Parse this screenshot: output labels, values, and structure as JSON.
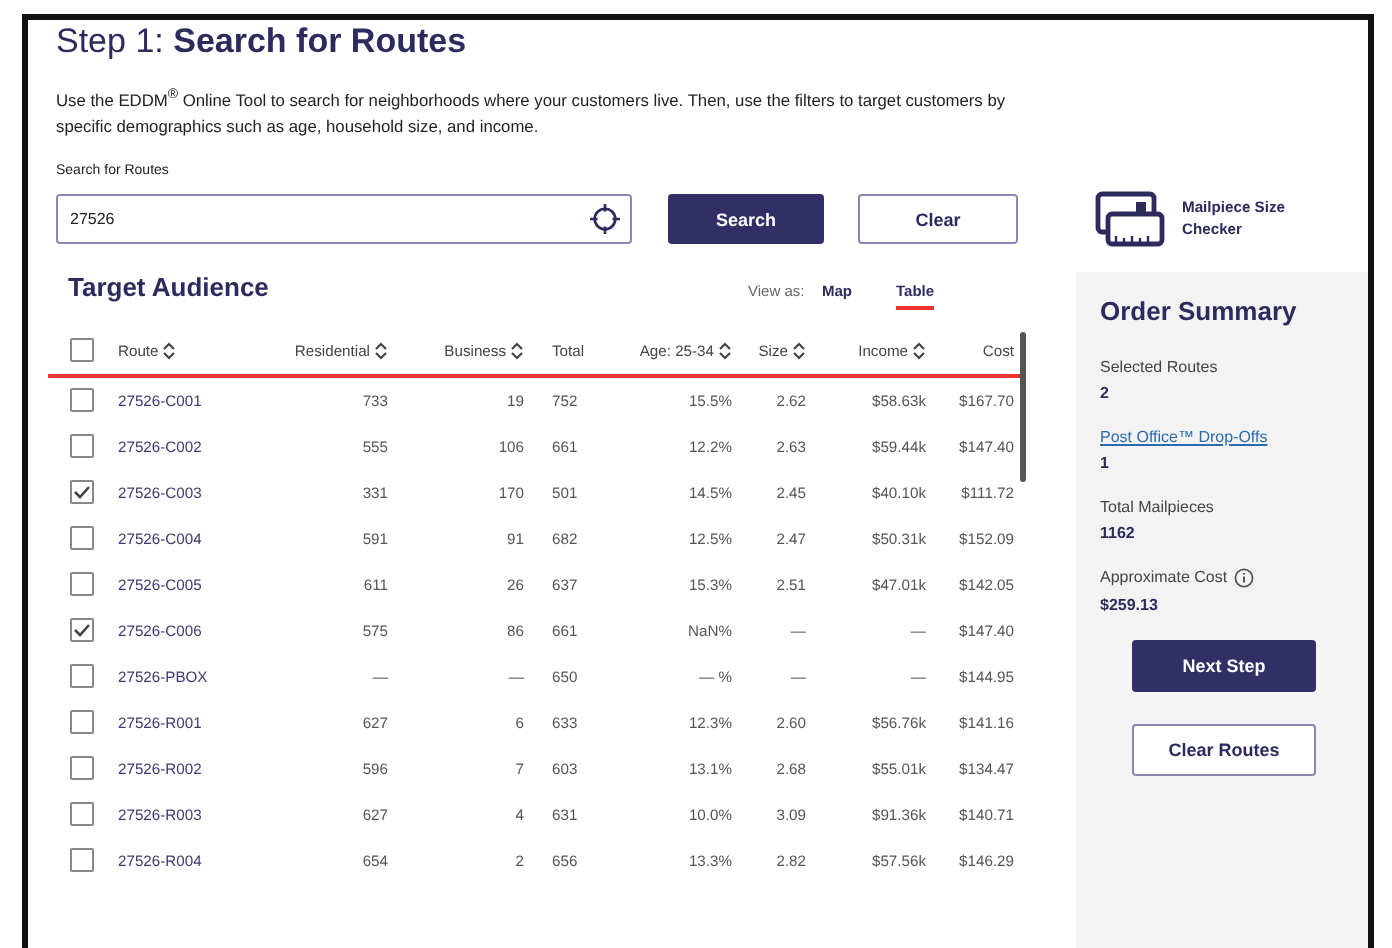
{
  "header": {
    "step": "Step 1:",
    "title": "Search for Routes",
    "intro": "Use the EDDM$^{®}$ Online Tool to search for neighborhoods where your customers live. Then, use the filters to target customers by specific demographics such as age, household size, and income."
  },
  "search": {
    "label": "Search for Routes",
    "value": "27526",
    "search_button": "Search",
    "clear_button": "Clear",
    "checker_link": "Mailpiece Size Checker"
  },
  "target_audience": {
    "title": "Target Audience",
    "view_label": "View as:",
    "views": [
      {
        "label": "Map",
        "selected": false
      },
      {
        "label": "Table",
        "selected": true
      }
    ]
  },
  "table": {
    "all_checked": false,
    "columns": [
      {
        "label": "Route",
        "sortable": true
      },
      {
        "label": "Residential",
        "sortable": true
      },
      {
        "label": "Business",
        "sortable": true
      },
      {
        "label": "Total",
        "sortable": false
      },
      {
        "label": "Age: 25-34",
        "sortable": true
      },
      {
        "label": "Size",
        "sortable": true
      },
      {
        "label": "Income",
        "sortable": true
      },
      {
        "label": "Cost",
        "sortable": false
      }
    ],
    "rows": [
      {
        "checked": false,
        "cells": [
          "27526-C001",
          "733",
          "19",
          "752",
          "15.5%",
          "2.62",
          "$58.63k",
          "$167.70"
        ]
      },
      {
        "checked": false,
        "cells": [
          "27526-C002",
          "555",
          "106",
          "661",
          "12.2%",
          "2.63",
          "$59.44k",
          "$147.40"
        ]
      },
      {
        "checked": true,
        "cells": [
          "27526-C003",
          "331",
          "170",
          "501",
          "14.5%",
          "2.45",
          "$40.10k",
          "$111.72"
        ]
      },
      {
        "checked": false,
        "cells": [
          "27526-C004",
          "591",
          "91",
          "682",
          "12.5%",
          "2.47",
          "$50.31k",
          "$152.09"
        ]
      },
      {
        "checked": false,
        "cells": [
          "27526-C005",
          "611",
          "26",
          "637",
          "15.3%",
          "2.51",
          "$47.01k",
          "$142.05"
        ]
      },
      {
        "checked": true,
        "cells": [
          "27526-C006",
          "575",
          "86",
          "661",
          "NaN%",
          "—",
          "—",
          "$147.40"
        ]
      },
      {
        "checked": false,
        "cells": [
          "27526-PBOX",
          "—",
          "—",
          "650",
          "— %",
          "—",
          "—",
          "$144.95"
        ]
      },
      {
        "checked": false,
        "cells": [
          "27526-R001",
          "627",
          "6",
          "633",
          "12.3%",
          "2.60",
          "$56.76k",
          "$141.16"
        ]
      },
      {
        "checked": false,
        "cells": [
          "27526-R002",
          "596",
          "7",
          "603",
          "13.1%",
          "2.68",
          "$55.01k",
          "$134.47"
        ]
      },
      {
        "checked": false,
        "cells": [
          "27526-R003",
          "627",
          "4",
          "631",
          "10.0%",
          "3.09",
          "$91.36k",
          "$140.71"
        ]
      },
      {
        "checked": false,
        "cells": [
          "27526-R004",
          "654",
          "2",
          "656",
          "13.3%",
          "2.82",
          "$57.56k",
          "$146.29"
        ]
      }
    ]
  },
  "order_summary": {
    "title": "Order Summary",
    "items": [
      {
        "label": "Selected Routes",
        "value": "2",
        "kind": "plain"
      },
      {
        "label": "Post Office™ Drop-Offs",
        "value": "1",
        "kind": "link"
      },
      {
        "label": "Total Mailpieces",
        "value": "1162",
        "kind": "plain"
      },
      {
        "label": "Approximate Cost",
        "value": "$259.13",
        "kind": "info"
      }
    ],
    "next_button": "Next Step",
    "clear_button": "Clear Routes"
  }
}
